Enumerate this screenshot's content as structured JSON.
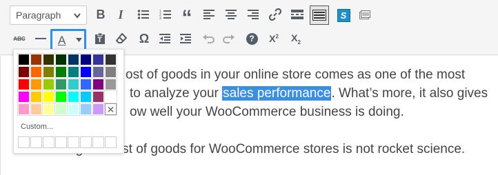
{
  "toolbar": {
    "format_select_value": "Paragraph",
    "row1_icons": [
      "bold-icon",
      "italic-icon",
      "bulleted-list-icon",
      "numbered-list-icon",
      "blockquote-icon",
      "align-left-icon",
      "align-center-icon",
      "align-right-icon",
      "insert-link-icon",
      "read-more-icon",
      "toolbar-toggle-icon",
      "plugin-s-icon",
      "media-icon"
    ],
    "row2_icons": [
      "strikethrough-icon",
      "horizontal-line-icon",
      "text-color-icon",
      "paste-as-text-icon",
      "clear-formatting-icon",
      "special-character-icon",
      "decrease-indent-icon",
      "increase-indent-icon",
      "undo-icon",
      "redo-icon",
      "keyboard-shortcuts-icon",
      "superscript-icon",
      "subscript-icon"
    ],
    "bold_glyph": "B",
    "italic_glyph": "I",
    "blockquote_glyph": "“",
    "text_color_glyph": "A",
    "strike_glyph": "ABC",
    "omega_glyph": "Ω",
    "help_glyph": "?",
    "sup_glyph": "X",
    "sup_small": "2",
    "sub_glyph": "X",
    "sub_small": "2",
    "s_plugin_glyph": "S"
  },
  "palette": {
    "colors": [
      "#000000",
      "#993300",
      "#333300",
      "#003300",
      "#003366",
      "#000080",
      "#333399",
      "#333333",
      "#800000",
      "#FF6600",
      "#808000",
      "#008000",
      "#008080",
      "#0000FF",
      "#666699",
      "#808080",
      "#FF0000",
      "#FF9900",
      "#99CC00",
      "#339966",
      "#33CCCC",
      "#3366FF",
      "#800080",
      "#999999",
      "#FF00FF",
      "#FFCC00",
      "#FFFF00",
      "#00FF00",
      "#00FFFF",
      "#00CCFF",
      "#993366",
      "#FFFFFF",
      "#FF99CC",
      "#FFCC99",
      "#FFFF99",
      "#CCFFCC",
      "#CCFFFF",
      "#99CCFF",
      "#CC99FF"
    ],
    "remove_glyph": "✕",
    "custom_label": "Custom...",
    "empty_slots": 8
  },
  "editor": {
    "line1": "ost of goods in your online store comes as one of the most",
    "line2_before": "to analyze your ",
    "line2_highlight": "sales performance",
    "line2_after": ". What’s more, it also gives",
    "line3": "ow well your WooCommerce business is doing.",
    "line4": "Tracking the cost of goods for WooCommerce stores is not rocket science."
  },
  "colors": {
    "highlight": "#3a8ee6",
    "active_border": "#2a8ff0",
    "plugin_s": "#1f8fc7"
  }
}
